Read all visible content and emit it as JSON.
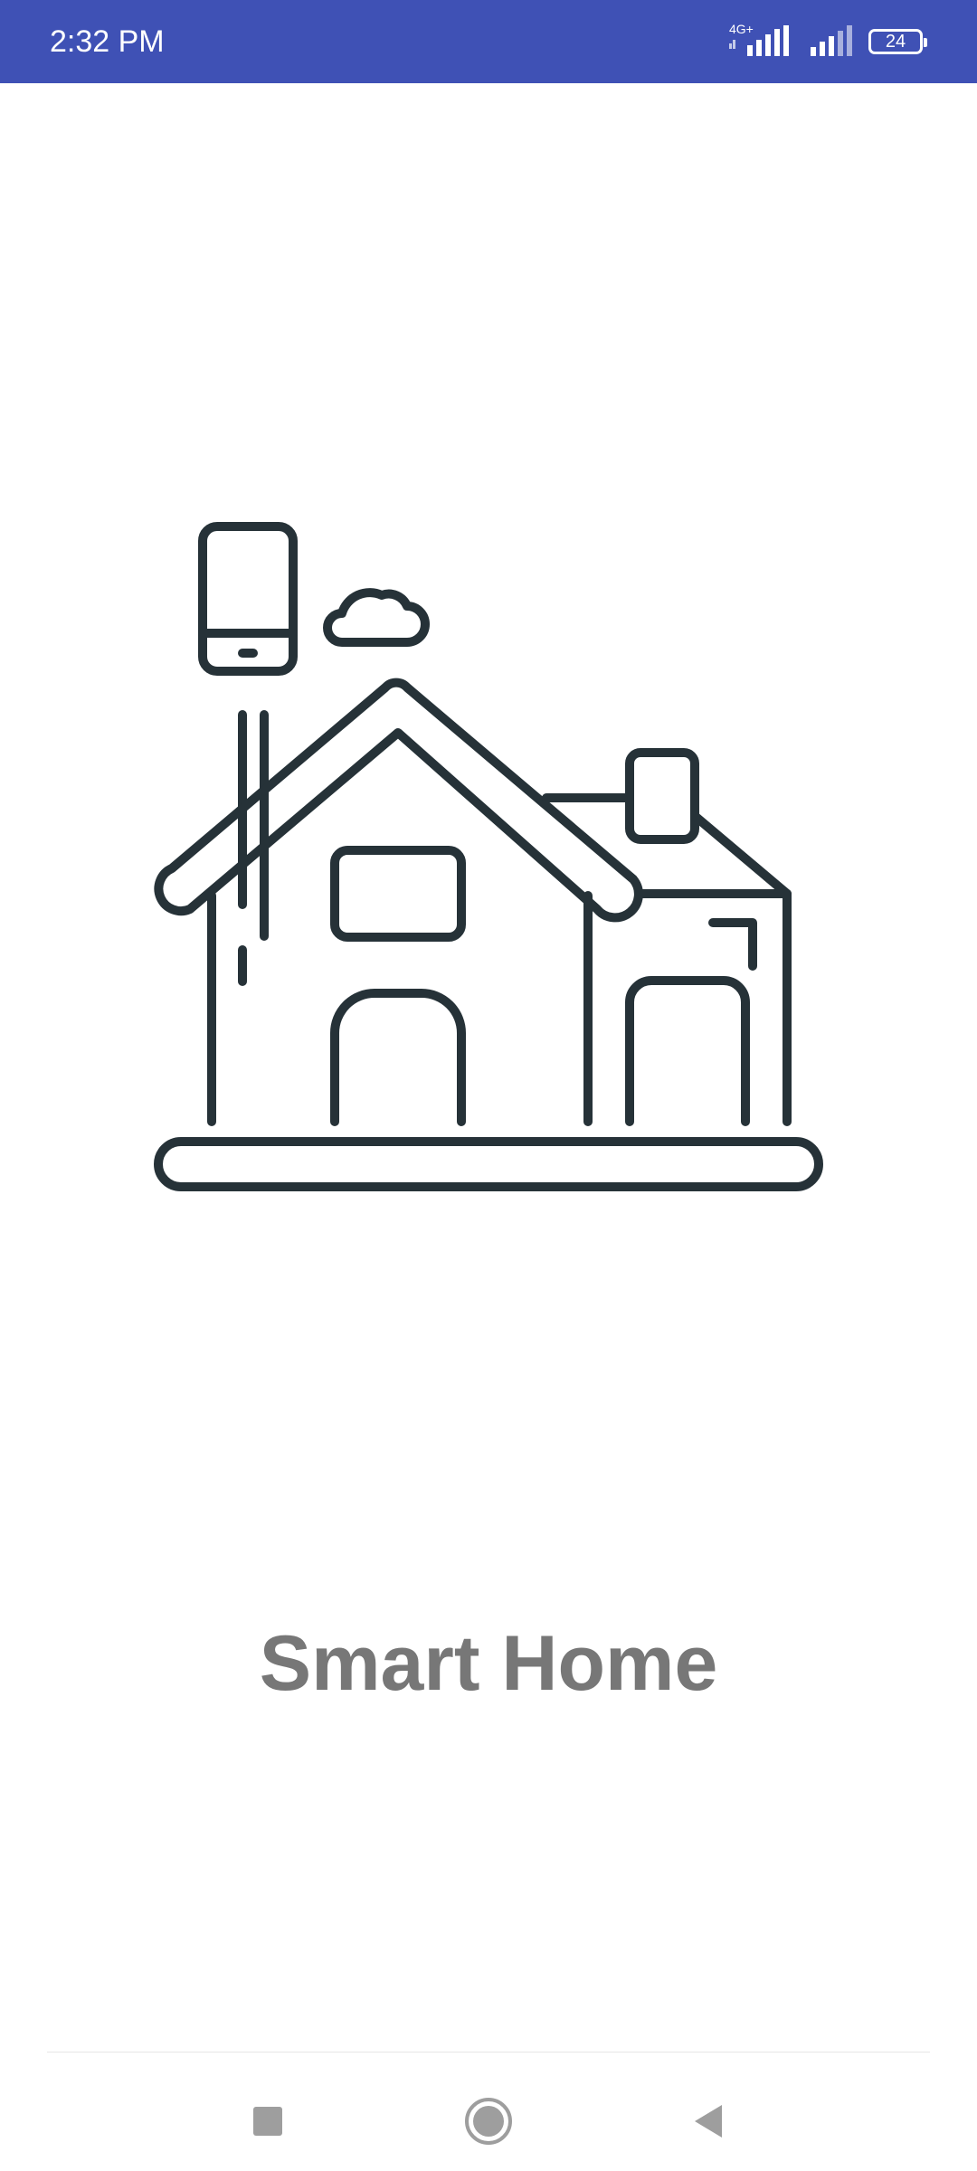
{
  "status_bar": {
    "time": "2:32 PM",
    "network_label": "4G+",
    "battery_level": "24",
    "background_color": "#3f51b5"
  },
  "illustration": {
    "icon": "smart-home-house-icon",
    "stroke_color": "#263238"
  },
  "main": {
    "title": "Smart Home",
    "title_color": "#777777"
  },
  "navigation_bar": {
    "buttons": [
      "recent-apps",
      "home",
      "back"
    ],
    "icon_color": "#9e9e9e"
  }
}
